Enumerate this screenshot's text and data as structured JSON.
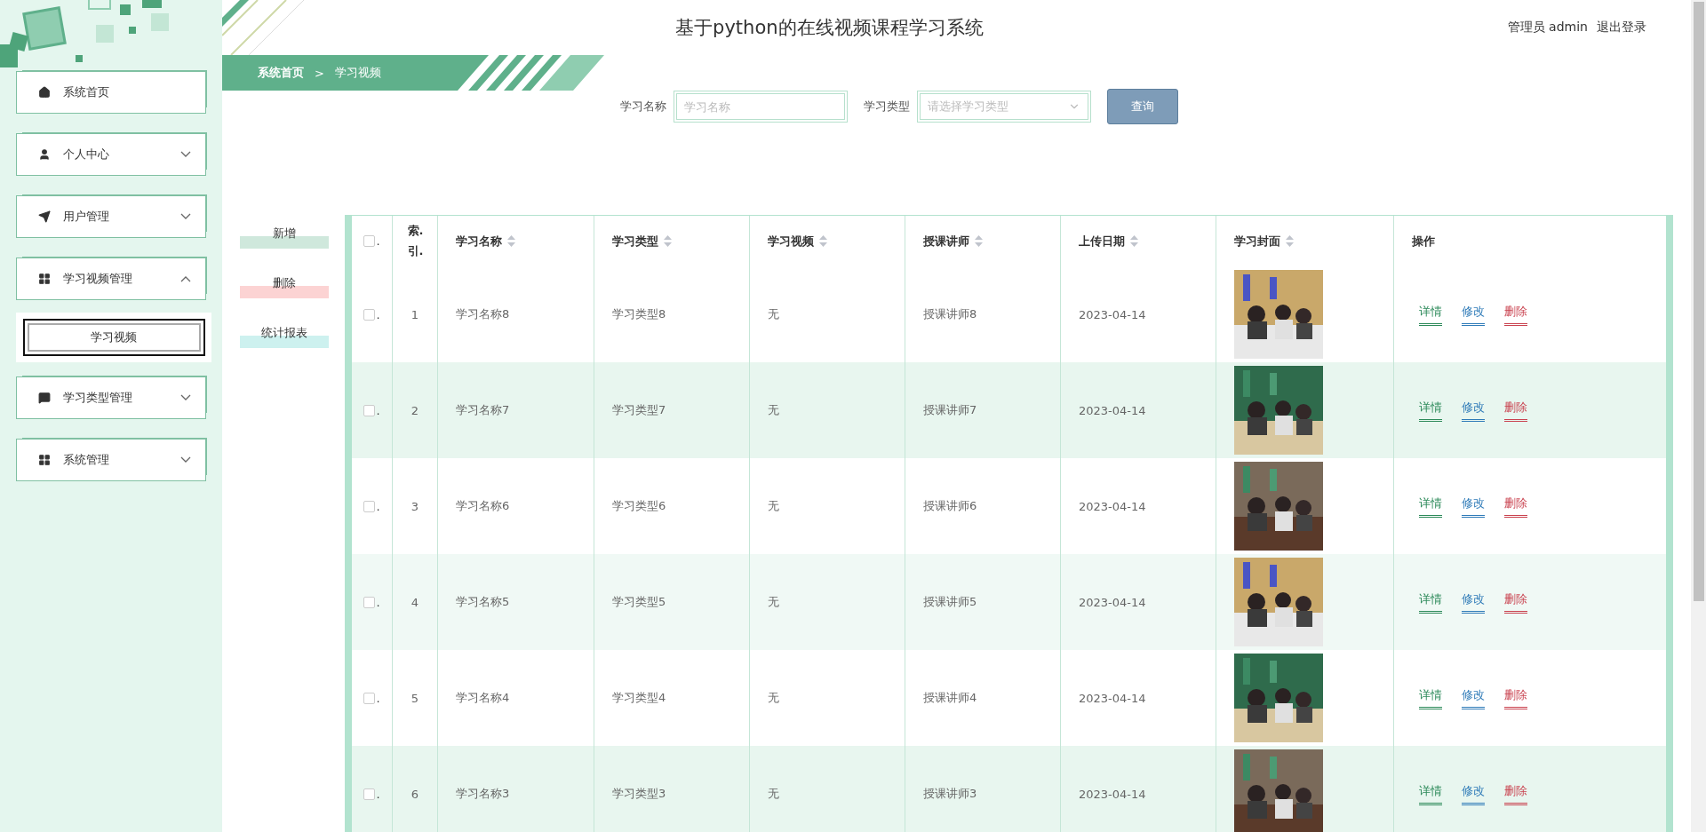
{
  "header": {
    "title": "基于python的在线视频课程学习系统",
    "user": "管理员 admin",
    "logout": "退出登录"
  },
  "sidebar": {
    "items": [
      {
        "kind": "link",
        "label": "系统首页"
      },
      {
        "kind": "group",
        "label": "个人中心",
        "expanded": false
      },
      {
        "kind": "group",
        "label": "用户管理",
        "expanded": false
      },
      {
        "kind": "group",
        "label": "学习视频管理",
        "expanded": true,
        "children": [
          {
            "label": "学习视频",
            "selected": true
          }
        ]
      },
      {
        "kind": "group",
        "label": "学习类型管理",
        "expanded": false
      },
      {
        "kind": "group",
        "label": "系统管理",
        "expanded": false
      }
    ]
  },
  "breadcrumb": {
    "items": [
      "系统首页",
      "学习视频"
    ],
    "separator": ">"
  },
  "search": {
    "fields": [
      {
        "kind": "input",
        "label": "学习名称",
        "placeholder": "学习名称"
      },
      {
        "kind": "select",
        "label": "学习类型",
        "placeholder": "请选择学习类型"
      }
    ],
    "button": "查询"
  },
  "actions": [
    {
      "label": "新增",
      "color": "#cfe8dc"
    },
    {
      "label": "删除",
      "color": "#fcd3d3"
    },
    {
      "label": "统计报表",
      "color": "#cdf1ef"
    }
  ],
  "table": {
    "select_all_checked": false,
    "select_mark": ".",
    "columns": [
      {
        "kind": "plain",
        "label": "索.引."
      },
      {
        "kind": "sortable",
        "label": "学习名称"
      },
      {
        "kind": "sortable",
        "label": "学习类型"
      },
      {
        "kind": "sortable",
        "label": "学习视频"
      },
      {
        "kind": "sortable",
        "label": "授课讲师"
      },
      {
        "kind": "sortable",
        "label": "上传日期"
      },
      {
        "kind": "sortable",
        "label": "学习封面"
      },
      {
        "kind": "plain",
        "label": "操作"
      }
    ],
    "rows": [
      {
        "checked": false,
        "mark": ".",
        "index": "1",
        "name": "学习名称8",
        "type": "学习类型8",
        "video": "无",
        "teacher": "授课讲师8",
        "date": "2023-04-14",
        "actions": [
          "详情",
          "修改",
          "删除"
        ]
      },
      {
        "checked": false,
        "mark": ".",
        "index": "2",
        "name": "学习名称7",
        "type": "学习类型7",
        "video": "无",
        "teacher": "授课讲师7",
        "date": "2023-04-14",
        "actions": [
          "详情",
          "修改",
          "删除"
        ]
      },
      {
        "checked": false,
        "mark": ".",
        "index": "3",
        "name": "学习名称6",
        "type": "学习类型6",
        "video": "无",
        "teacher": "授课讲师6",
        "date": "2023-04-14",
        "actions": [
          "详情",
          "修改",
          "删除"
        ]
      },
      {
        "checked": false,
        "mark": ".",
        "index": "4",
        "name": "学习名称5",
        "type": "学习类型5",
        "video": "无",
        "teacher": "授课讲师5",
        "date": "2023-04-14",
        "actions": [
          "详情",
          "修改",
          "删除"
        ]
      },
      {
        "checked": false,
        "mark": ".",
        "index": "5",
        "name": "学习名称4",
        "type": "学习类型4",
        "video": "无",
        "teacher": "授课讲师4",
        "date": "2023-04-14",
        "actions": [
          "详情",
          "修改",
          "删除"
        ]
      },
      {
        "checked": false,
        "mark": ".",
        "index": "6",
        "name": "学习名称3",
        "type": "学习类型3",
        "video": "无",
        "teacher": "授课讲师3",
        "date": "2023-04-14",
        "actions": [
          "详情",
          "修改",
          "删除"
        ]
      }
    ]
  }
}
